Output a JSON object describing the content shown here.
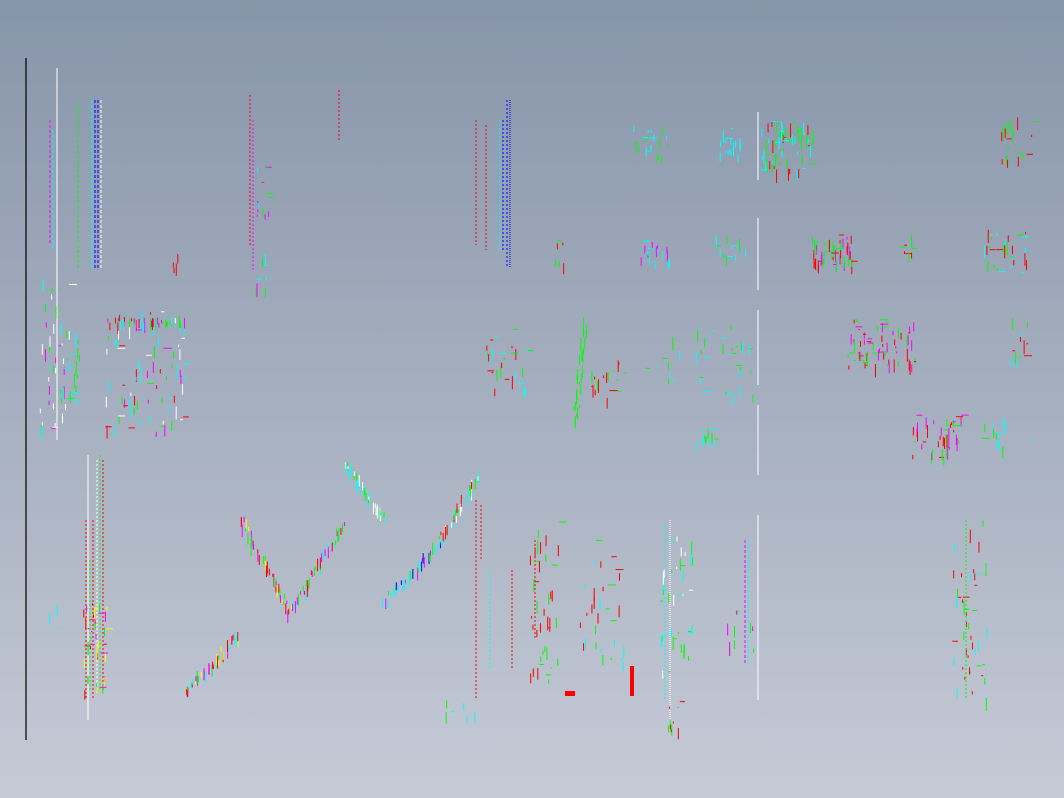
{
  "viewport": {
    "type": "cad-model-space",
    "background_top": "#8795aa",
    "background_bottom": "#c5cad6"
  },
  "palette": {
    "red": "#ff0000",
    "green": "#00ff00",
    "cyan": "#00ffff",
    "blue": "#0000ff",
    "magenta": "#ff00ff",
    "yellow": "#ffff00",
    "white": "#ffffff",
    "black": "#000000"
  }
}
